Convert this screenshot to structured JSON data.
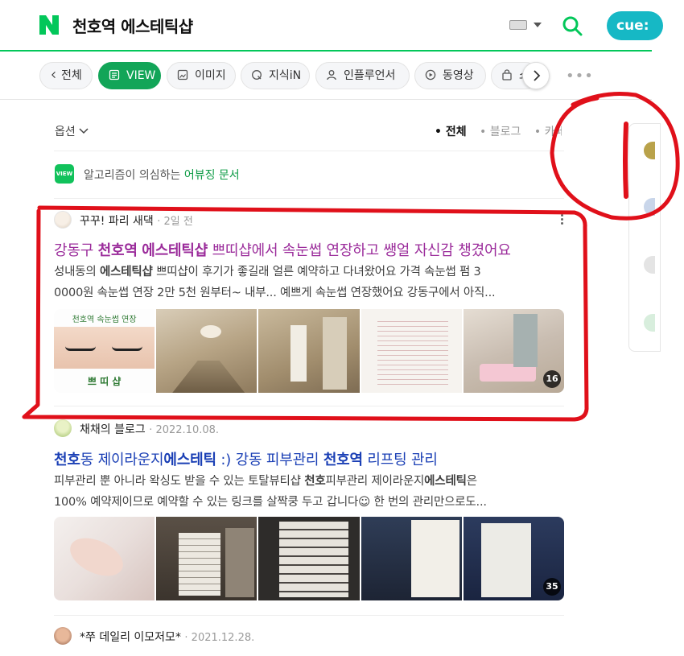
{
  "header": {
    "query": "천호역 에스테틱샵",
    "cue_label": "cue:"
  },
  "tabs": [
    {
      "label": "전체",
      "icon": "chevron-left-icon"
    },
    {
      "label": "VIEW",
      "icon": "document-icon",
      "active": true
    },
    {
      "label": "이미지",
      "icon": "image-icon"
    },
    {
      "label": "지식iN",
      "icon": "q-icon"
    },
    {
      "label": "인플루언서",
      "icon": "person-icon"
    },
    {
      "label": "동영상",
      "icon": "play-icon"
    },
    {
      "label": "쇼",
      "icon": "bag-icon"
    }
  ],
  "options": {
    "label": "옵션",
    "filters": [
      "전체",
      "블로그",
      "카페"
    ],
    "active_filter": "전체"
  },
  "algo_notice": {
    "badge": "VIEW",
    "text": "알고리즘이 의심하는",
    "link": "어뷰징 문서"
  },
  "posts": [
    {
      "author": "꾸꾸! 파리 새댁",
      "date": "2일 전",
      "title_parts": [
        "강동구 ",
        "천호역",
        " ",
        "에스테틱샵",
        " 쁘띠샵에서 속눈썹 연장하고 쌩얼 자신감 챙겼어요"
      ],
      "desc_line1_parts": [
        "성내동의 ",
        "에스테틱샵",
        " 쁘띠샵이 후기가 좋길래 얼른 예약하고 다녀왔어요 가격 속눈썹 펌 3"
      ],
      "desc_line2": "0000원 속눈썹 연장 2만 5천 원부터~ 내부... 예쁘게 속눈썹 연장했어요 강동구에서 아직...",
      "thumb_caption_top": "천호역 속눈썹 연장",
      "thumb_caption_bottom": "쁘 띠 샵",
      "image_count": "16",
      "title_color": "#9b2c9b"
    },
    {
      "author": "채채의 블로그",
      "date": "2022.10.08.",
      "title_parts": [
        "천호",
        "동 제이라운지",
        "에스테틱",
        " :) 강동 피부관리 ",
        "천호역",
        " 리프팅 관리"
      ],
      "desc_line1_parts": [
        "피부관리 뿐 아니라 왁싱도 받을 수 있는 토탈뷰티샵 ",
        "천호",
        "피부관리 제이라운지",
        "에스테틱",
        "은"
      ],
      "desc_line2": "100% 예약제이므로 예약할 수 있는 링크를 살짝쿵 두고 갑니다☺ 한 번의 관리만으로도...",
      "image_count": "35",
      "title_color": "#1a3fb5"
    },
    {
      "author": "*쭈 데일리 이모저모*",
      "date": "2021.12.28."
    }
  ],
  "colors": {
    "naver_green": "#03c75a",
    "view_green": "#12a558",
    "annotation_red": "#e0101a"
  }
}
